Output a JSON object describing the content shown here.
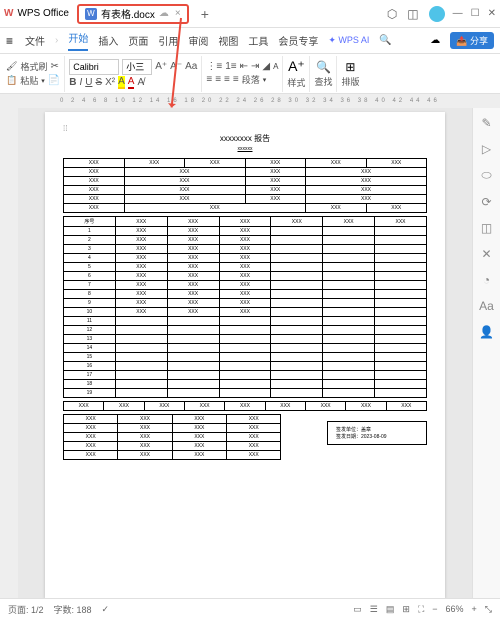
{
  "app": {
    "logo": "W",
    "name": "WPS Office"
  },
  "tab": {
    "icon": "W",
    "name": "有表格.docx"
  },
  "titleIcons": {
    "cube": "⬡",
    "box": "◫"
  },
  "winBtns": {
    "min": "—",
    "max": "☐",
    "close": "✕"
  },
  "menu": {
    "hamburger": "≡",
    "file": "文件",
    "items": [
      "开始",
      "插入",
      "页面",
      "引用",
      "审阅",
      "视图",
      "工具",
      "会员专享"
    ],
    "active": 0,
    "ai": "WPS AI",
    "search": "🔍",
    "cloud": "☁",
    "share": "分享"
  },
  "toolbar": {
    "formatPainter": "格式刷",
    "paste": "粘贴",
    "cut": "✂",
    "copy": "📋",
    "font": "Calibri",
    "size": "小三",
    "bold": "B",
    "italic": "I",
    "underline": "U",
    "strike": "S",
    "super": "A",
    "sub": "A",
    "case": "A",
    "alignL": "≡",
    "alignC": "≡",
    "alignR": "≡",
    "listB": "⋮",
    "listN": "⋮",
    "indent": "⇥",
    "para": "段落",
    "style": "样式",
    "find": "查找",
    "arrange": "排版"
  },
  "ruler": "0  2  4  6  8  10 12 14 16 18 20 22 24 26 28 30 32 34 36 38 40 42 44 46",
  "doc": {
    "title": "xxxxxxxx 报告",
    "sub": "xxxxxx",
    "x": "XXX",
    "seqHead": "序号",
    "sig1": "签发单位：盖章",
    "sig2": "签发日期：2023-08-09"
  },
  "rail": [
    "✎",
    "▷",
    "⬭",
    "⟳",
    "◫",
    "✕",
    "◔",
    "Aa",
    "👤"
  ],
  "status": {
    "page": "页面: 1/2",
    "words": "字数: 188",
    "spell": "✓",
    "views": [
      "▭",
      "☰",
      "▤",
      "⊞"
    ],
    "fit": "⛶",
    "zoom": "66%",
    "minus": "−",
    "plus": "+",
    "expand": "⤡"
  }
}
